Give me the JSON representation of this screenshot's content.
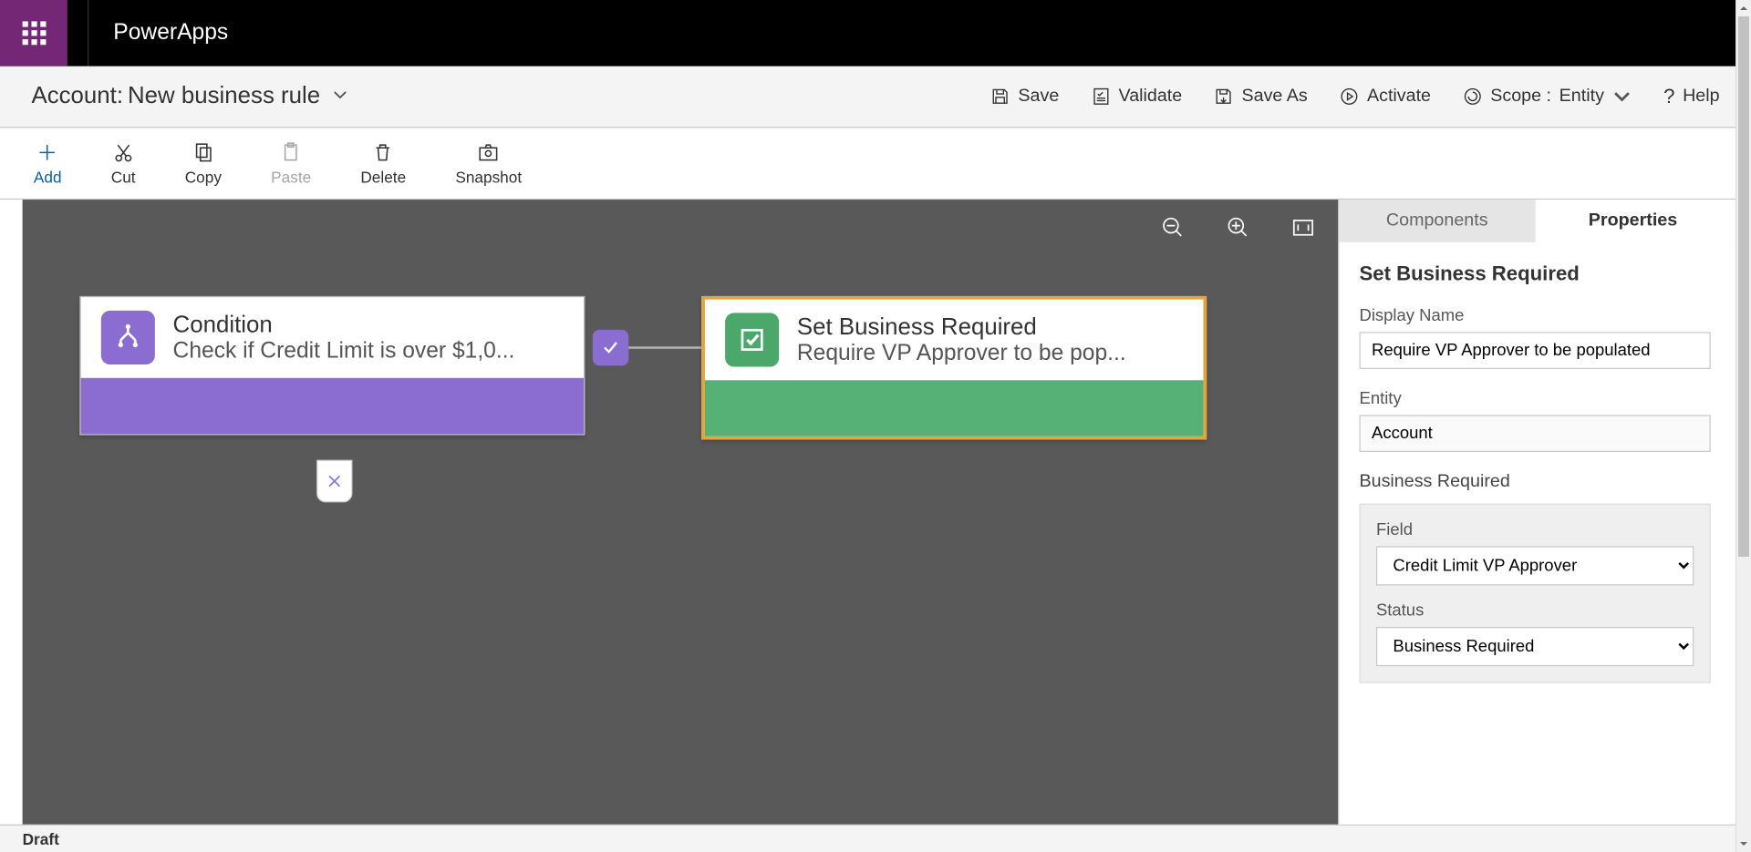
{
  "app": {
    "title": "PowerApps"
  },
  "subheader": {
    "prefix": "Account:",
    "name": "New business rule",
    "actions": {
      "save": "Save",
      "validate": "Validate",
      "save_as": "Save As",
      "activate": "Activate",
      "scope_label": "Scope :",
      "scope_value": "Entity",
      "help": "Help"
    }
  },
  "ribbon": {
    "add": "Add",
    "cut": "Cut",
    "copy": "Copy",
    "paste": "Paste",
    "delete": "Delete",
    "snapshot": "Snapshot"
  },
  "canvas": {
    "condition": {
      "title": "Condition",
      "subtitle": "Check if Credit Limit is over $1,0..."
    },
    "action": {
      "title": "Set Business Required",
      "subtitle": "Require VP Approver to be pop..."
    }
  },
  "panel": {
    "tab_components": "Components",
    "tab_properties": "Properties",
    "title": "Set Business Required",
    "display_name_label": "Display Name",
    "display_name_value": "Require VP Approver to be populated",
    "entity_label": "Entity",
    "entity_value": "Account",
    "section_title": "Business Required",
    "field_label": "Field",
    "field_value": "Credit Limit VP Approver",
    "status_label": "Status",
    "status_value": "Business Required"
  },
  "status": "Draft"
}
